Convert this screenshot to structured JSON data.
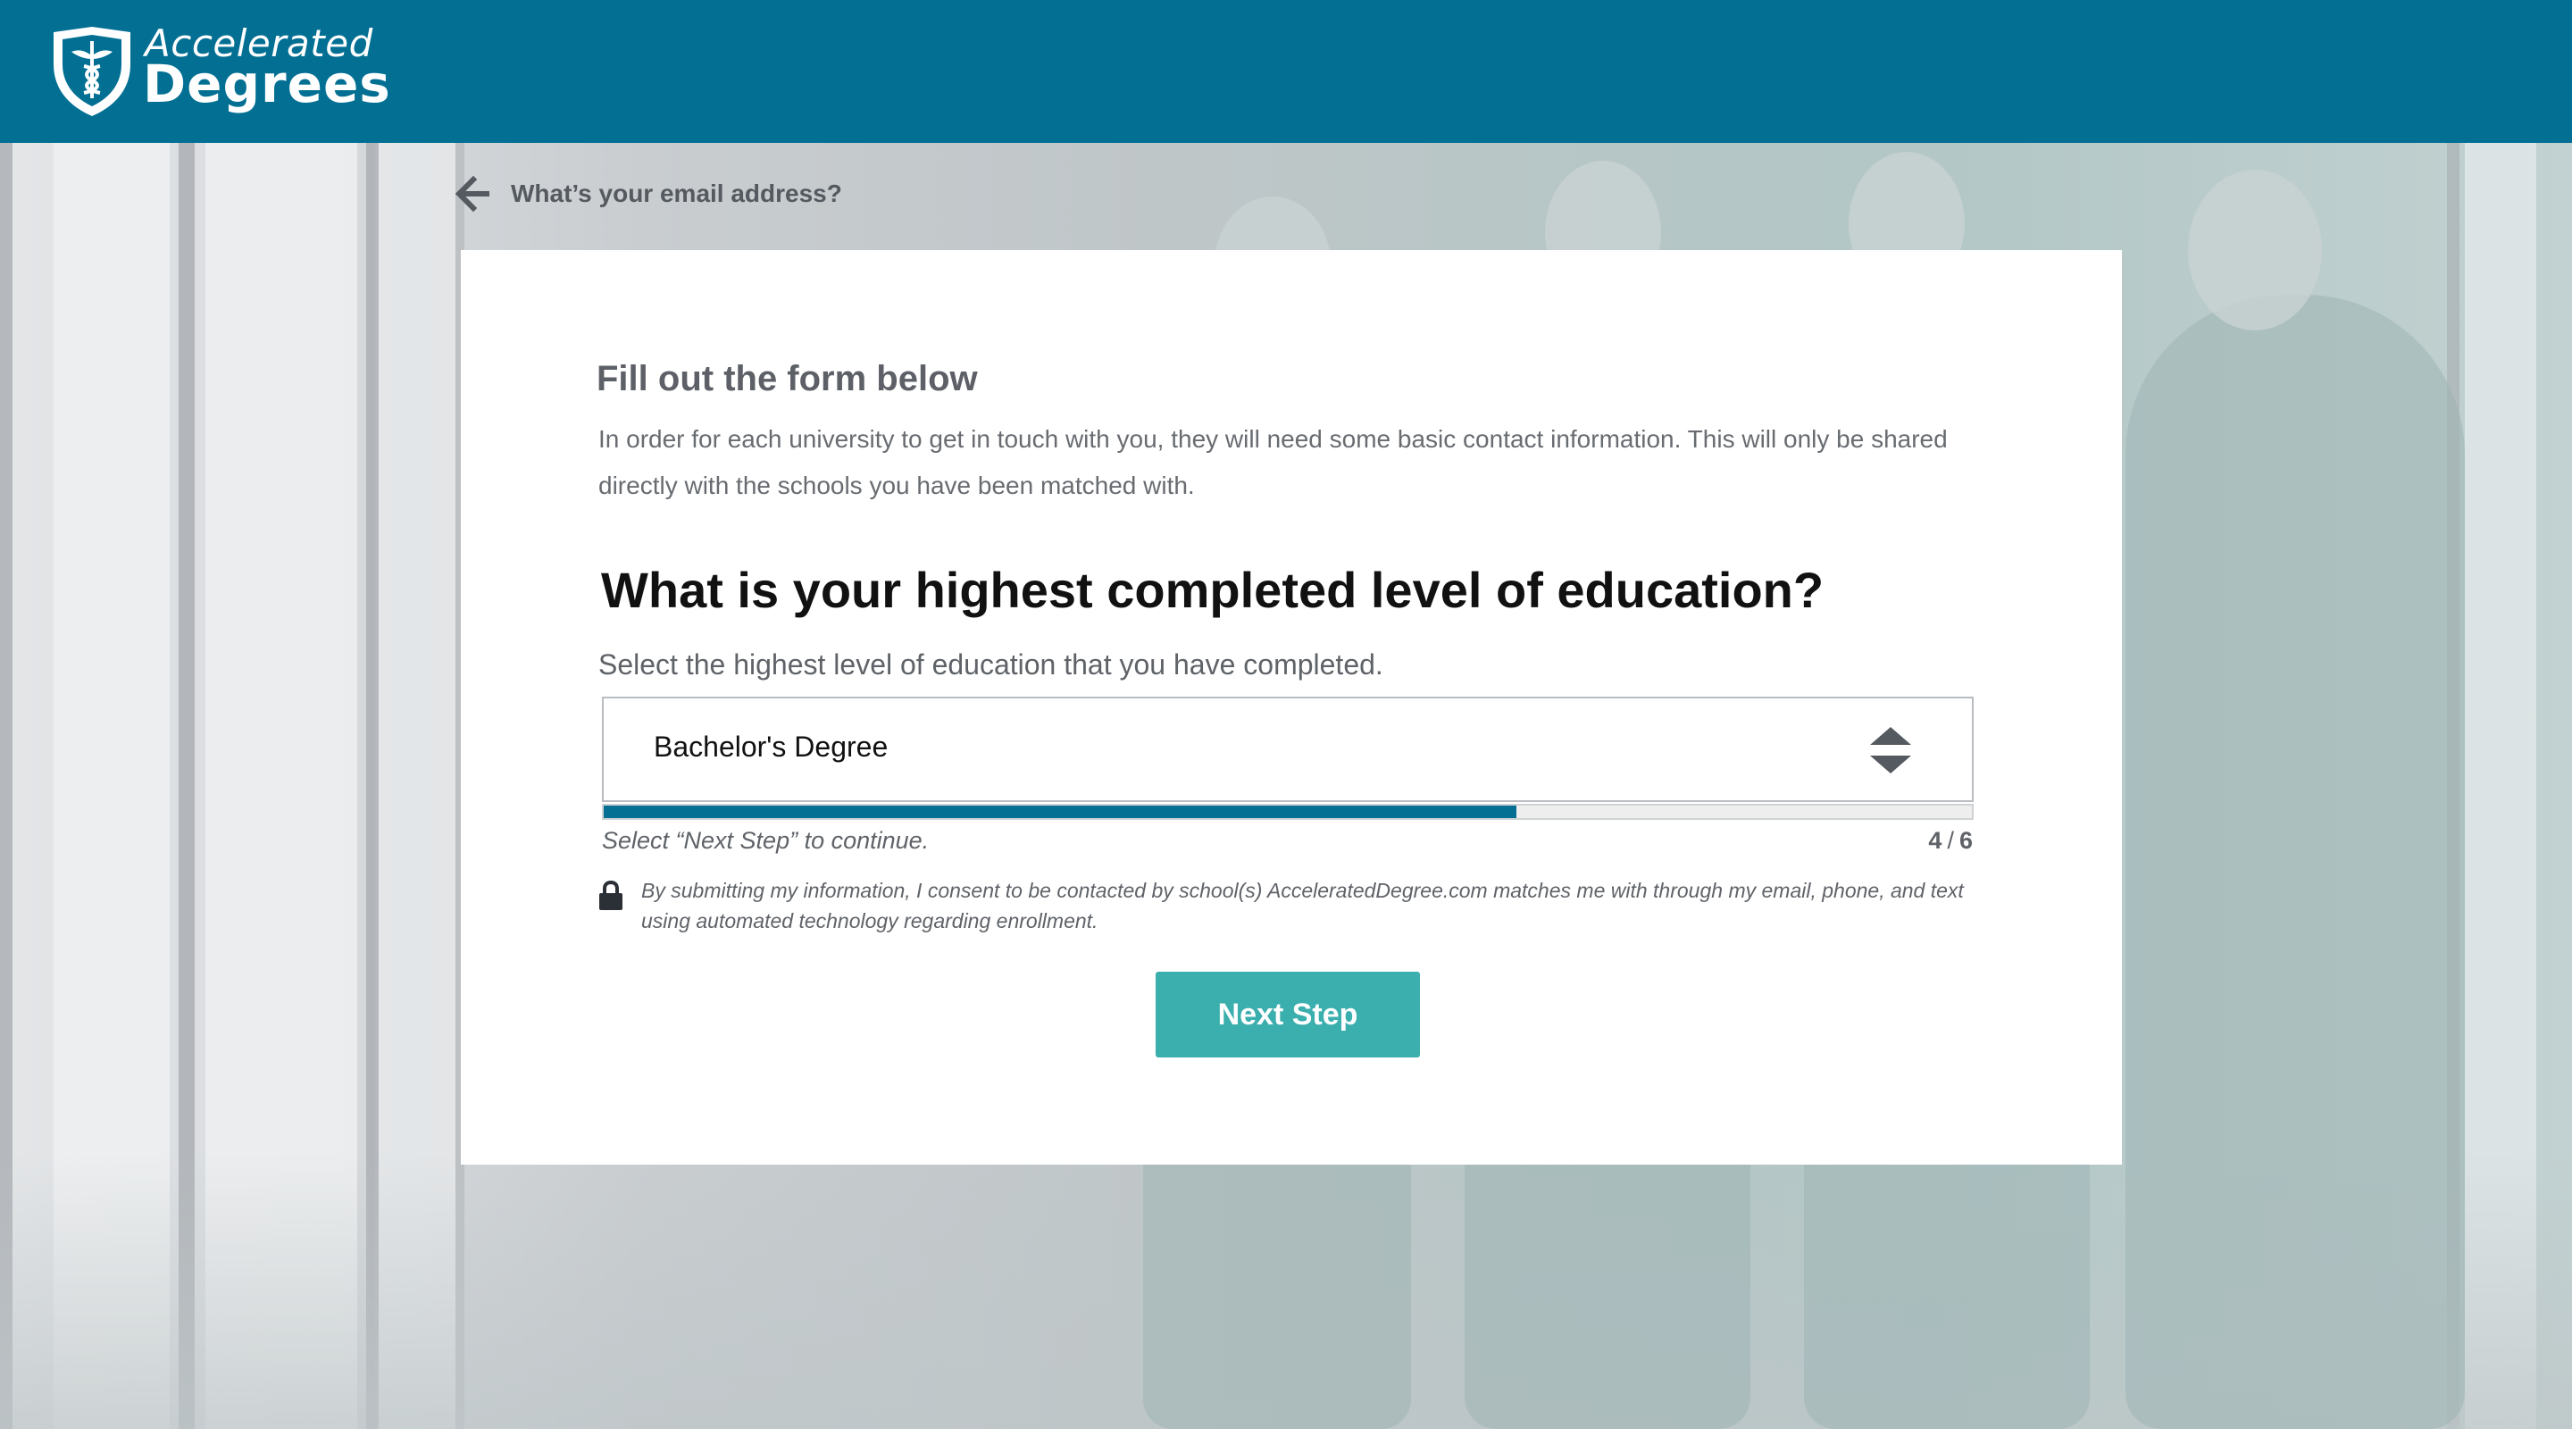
{
  "header": {
    "logo_top": "Accelerated",
    "logo_bottom": "Degrees",
    "background_color": "#026f93"
  },
  "back_link": {
    "icon": "arrow-left-icon",
    "label": "What’s your email address?"
  },
  "form": {
    "title": "Fill out the form below",
    "description": "In order for each university to get in touch with you, they will need some basic contact information. This will only be shared directly with the schools you have been matched with.",
    "question": "What is your highest completed level of education?",
    "sub_question": "Select the highest level of education that you have completed.",
    "select": {
      "selected_value": "Bachelor's Degree",
      "icon": "select-arrows-icon"
    },
    "progress": {
      "current": "4",
      "separator": "/",
      "total": "6",
      "fill_fraction": 0.667,
      "fill_color": "#026f93"
    },
    "hint": "Select “Next Step” to continue.",
    "consent": {
      "icon": "lock-icon",
      "text": "By submitting my information, I consent to be contacted by school(s) AcceleratedDegree.com matches me with through my email, phone, and text using automated technology regarding enrollment."
    },
    "next_button": {
      "label": "Next Step",
      "color": "#3baeae"
    }
  }
}
